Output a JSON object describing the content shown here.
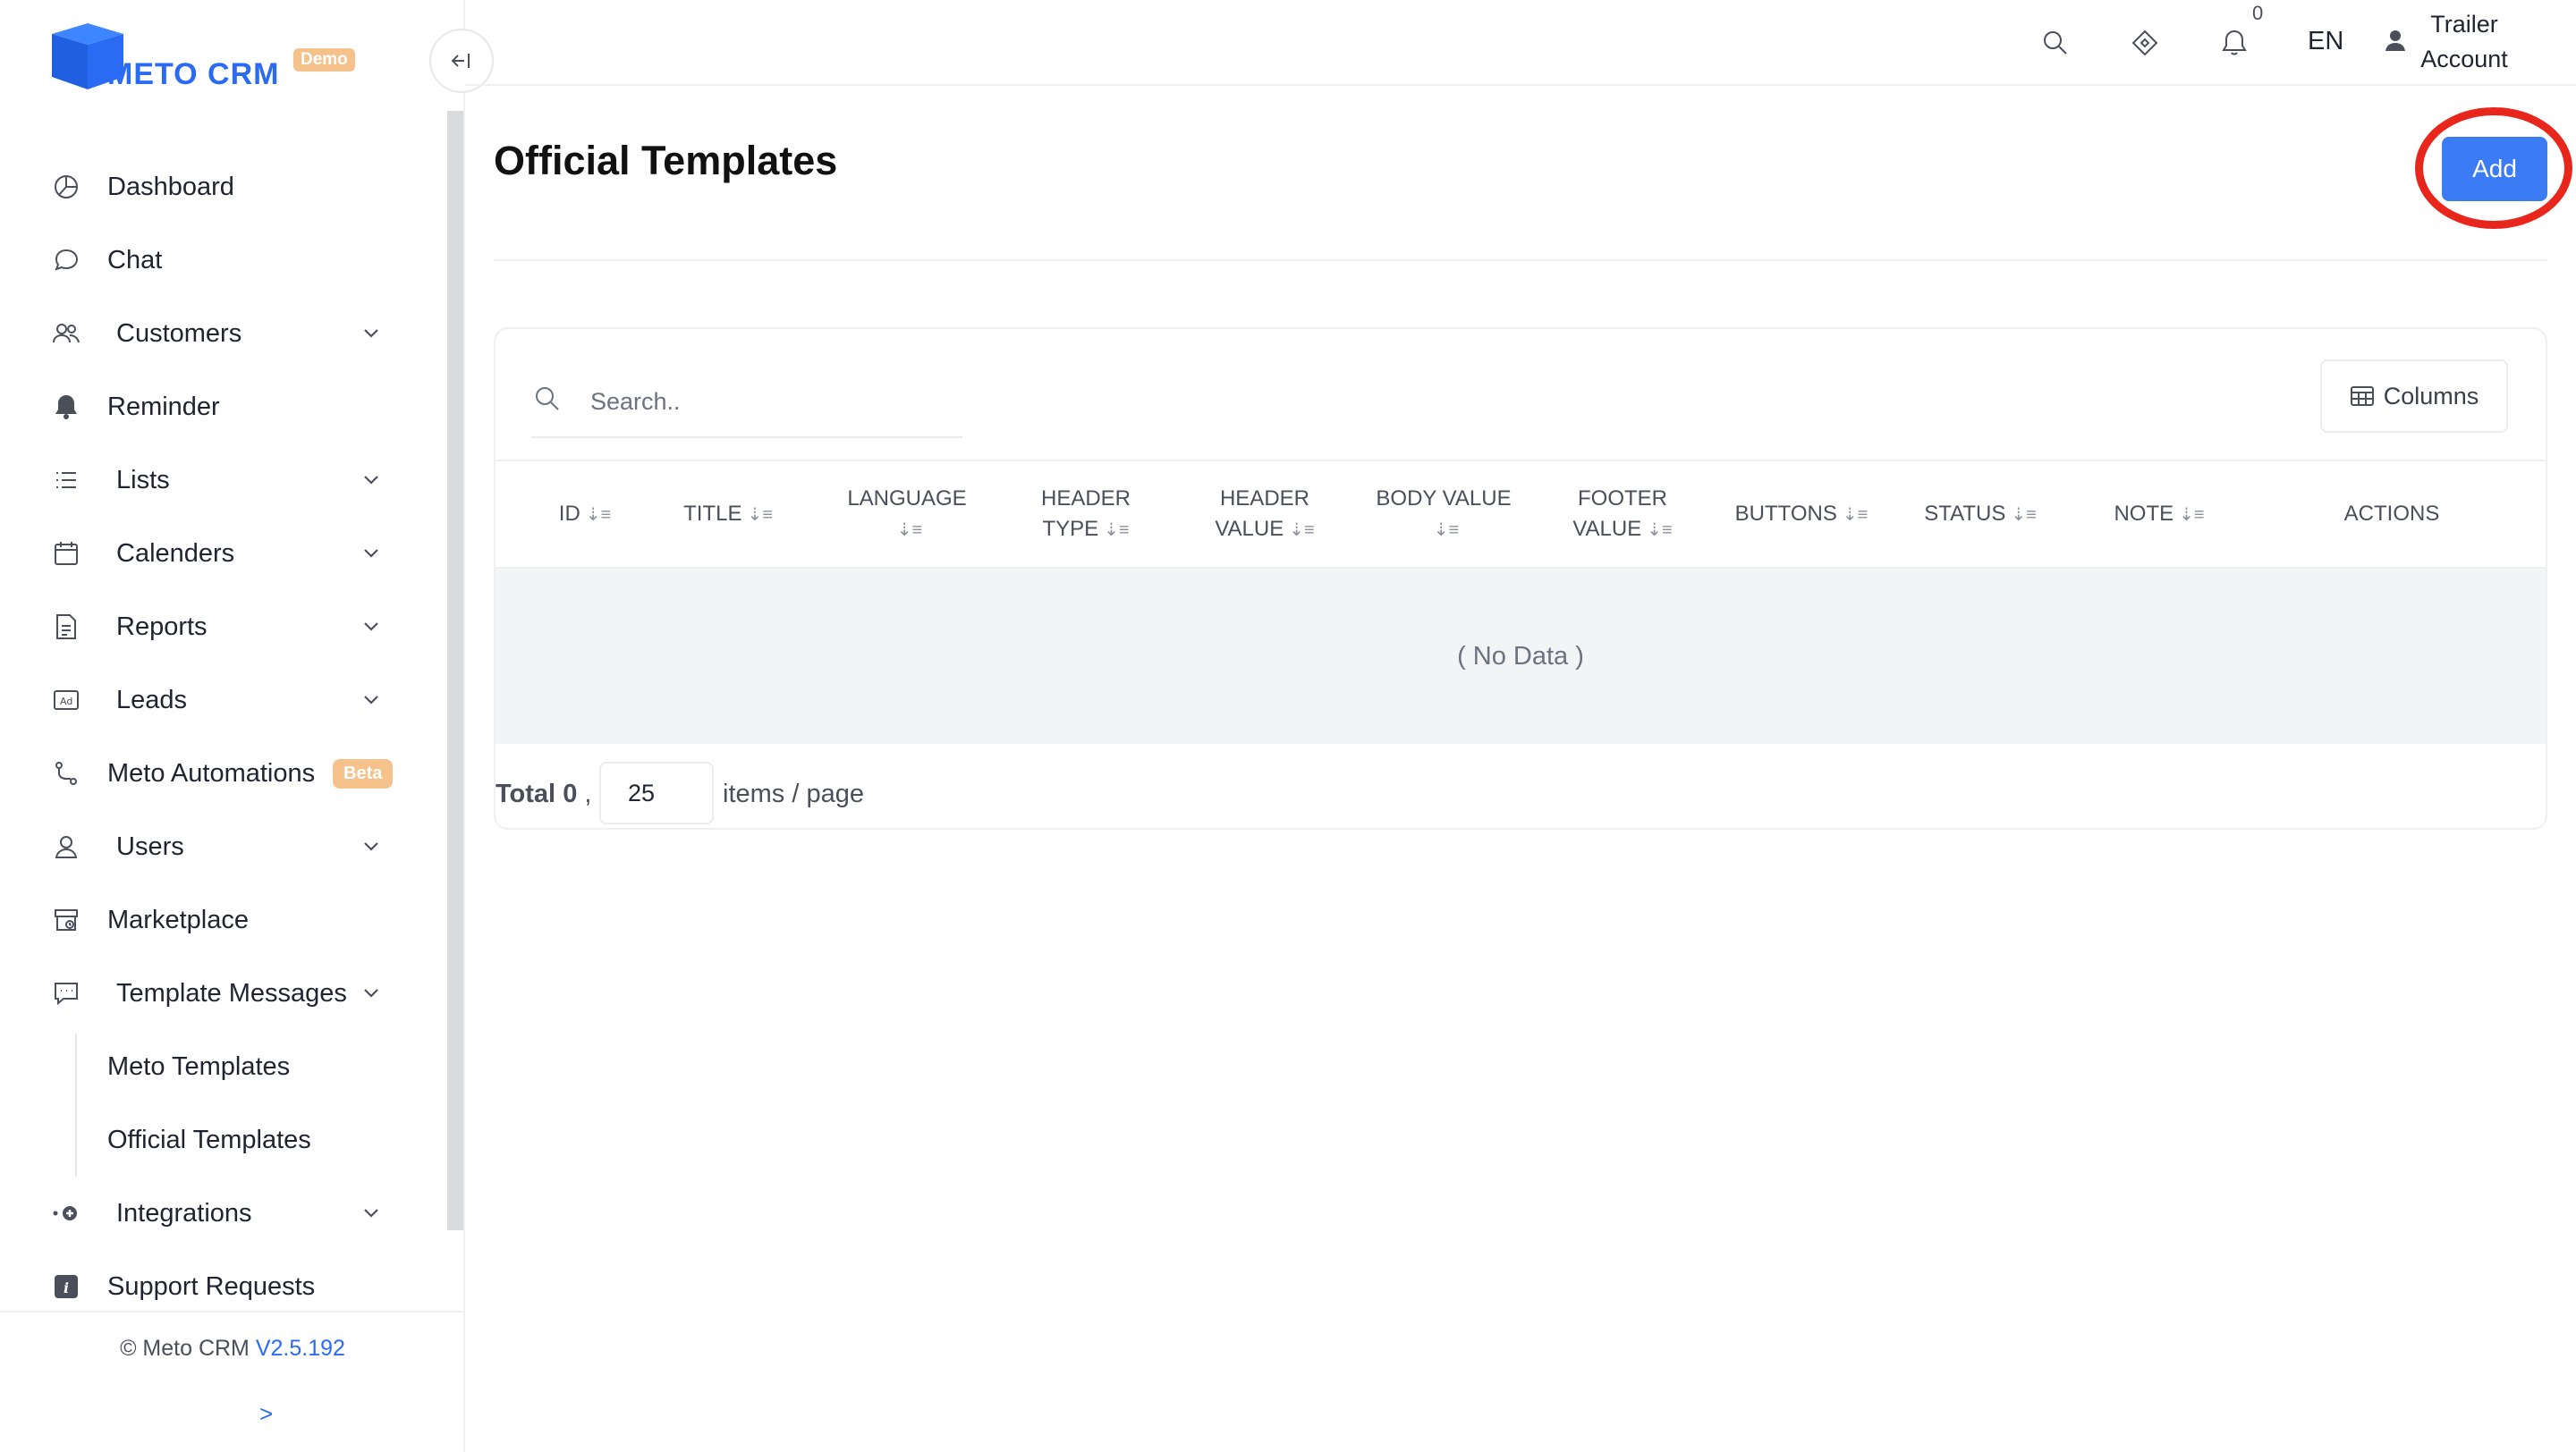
{
  "brand": {
    "name": "METO CRM",
    "badge": "Demo"
  },
  "sidebar": {
    "items": [
      {
        "label": "Dashboard",
        "icon": "dashboard-icon"
      },
      {
        "label": "Chat",
        "icon": "chat-icon"
      },
      {
        "label": "Customers",
        "icon": "customers-icon",
        "expandable": true
      },
      {
        "label": "Reminder",
        "icon": "bell-icon"
      },
      {
        "label": "Lists",
        "icon": "list-icon",
        "expandable": true
      },
      {
        "label": "Calenders",
        "icon": "calendar-icon",
        "expandable": true
      },
      {
        "label": "Reports",
        "icon": "report-icon",
        "expandable": true
      },
      {
        "label": "Leads",
        "icon": "ad-icon",
        "expandable": true
      },
      {
        "label": "Meto Automations",
        "icon": "automation-icon",
        "badge": "Beta"
      },
      {
        "label": "Users",
        "icon": "user-icon",
        "expandable": true
      },
      {
        "label": "Marketplace",
        "icon": "marketplace-icon"
      },
      {
        "label": "Template Messages",
        "icon": "message-icon",
        "expandable": true,
        "expanded": true
      },
      {
        "label": "Meto Templates",
        "sub": true
      },
      {
        "label": "Official Templates",
        "sub": true,
        "active": true
      },
      {
        "label": "Integrations",
        "icon": "integrations-icon",
        "expandable": true
      },
      {
        "label": "Support Requests",
        "icon": "info-icon"
      }
    ],
    "copyright": "© Meto CRM",
    "version": "V2.5.192",
    "expand_label": ">"
  },
  "topbar": {
    "notification_count": "0",
    "language": "EN",
    "user_line1": "Trailer",
    "user_line2": "Account"
  },
  "page": {
    "title": "Official Templates",
    "add_label": "Add"
  },
  "table": {
    "search_placeholder": "Search..",
    "columns_label": "Columns",
    "headers": [
      {
        "line1": "ID",
        "line2": ""
      },
      {
        "line1": "TITLE",
        "line2": ""
      },
      {
        "line1": "LANGUAGE",
        "line2": ""
      },
      {
        "line1": "HEADER",
        "line2": "TYPE"
      },
      {
        "line1": "HEADER",
        "line2": "VALUE"
      },
      {
        "line1": "BODY VALUE",
        "line2": ""
      },
      {
        "line1": "FOOTER",
        "line2": "VALUE"
      },
      {
        "line1": "BUTTONS",
        "line2": ""
      },
      {
        "line1": "STATUS",
        "line2": ""
      },
      {
        "line1": "NOTE",
        "line2": ""
      },
      {
        "line1": "ACTIONS",
        "line2": ""
      }
    ],
    "empty_text": "( No Data )",
    "total_label": "Total",
    "total_count": "0",
    "page_size": "25",
    "per_page_label": "items / page"
  },
  "colors": {
    "accent": "#3b7cf5",
    "highlight": "#e8261c",
    "badge": "#f6c28b"
  }
}
